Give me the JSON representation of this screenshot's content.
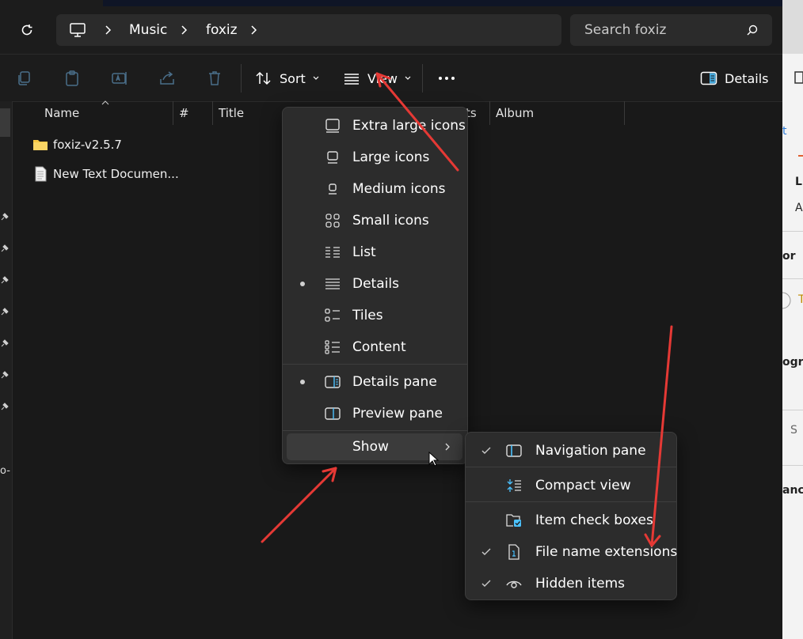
{
  "address": {
    "breadcrumbs": [
      "Music",
      "foxiz"
    ]
  },
  "search": {
    "placeholder": "Search foxiz"
  },
  "toolbar": {
    "sort_label": "Sort",
    "view_label": "View",
    "details_label": "Details"
  },
  "columns": [
    "Name",
    "#",
    "Title",
    "ts",
    "Album"
  ],
  "files": [
    {
      "name": "foxiz-v2.5.7",
      "icon": "folder-icon"
    },
    {
      "name": "New Text Documen...",
      "icon": "text-file-icon"
    }
  ],
  "nav_partial_text": "o-",
  "right_panel": {
    "texts": [
      "t",
      "Li",
      "A",
      "or",
      "T",
      "ogra",
      "S",
      "anc"
    ]
  },
  "view_menu": {
    "items": [
      {
        "label": "Extra large icons",
        "icon": "extra-large-icons-icon",
        "selected": false
      },
      {
        "label": "Large icons",
        "icon": "large-icons-icon",
        "selected": false
      },
      {
        "label": "Medium icons",
        "icon": "medium-icons-icon",
        "selected": false
      },
      {
        "label": "Small icons",
        "icon": "small-icons-icon",
        "selected": false
      },
      {
        "label": "List",
        "icon": "list-icon",
        "selected": false
      },
      {
        "label": "Details",
        "icon": "details-icon",
        "selected": true
      },
      {
        "label": "Tiles",
        "icon": "tiles-icon",
        "selected": false
      },
      {
        "label": "Content",
        "icon": "content-icon",
        "selected": false
      }
    ],
    "panes": [
      {
        "label": "Details pane",
        "icon": "details-pane-icon",
        "selected": true
      },
      {
        "label": "Preview pane",
        "icon": "preview-pane-icon",
        "selected": false
      }
    ],
    "show_label": "Show"
  },
  "show_menu": {
    "items": [
      {
        "label": "Navigation pane",
        "icon": "navigation-pane-icon",
        "checked": true
      },
      {
        "label": "Compact view",
        "icon": "compact-view-icon",
        "checked": false
      },
      {
        "label": "Item check boxes",
        "icon": "item-check-boxes-icon",
        "checked": false
      },
      {
        "label": "File name extensions",
        "icon": "file-name-extensions-icon",
        "checked": true
      },
      {
        "label": "Hidden items",
        "icon": "hidden-items-icon",
        "checked": true
      }
    ]
  },
  "colors": {
    "accent": "#4cc2ff",
    "annotation_arrow": "#e53935",
    "folder": "#f4c542"
  }
}
